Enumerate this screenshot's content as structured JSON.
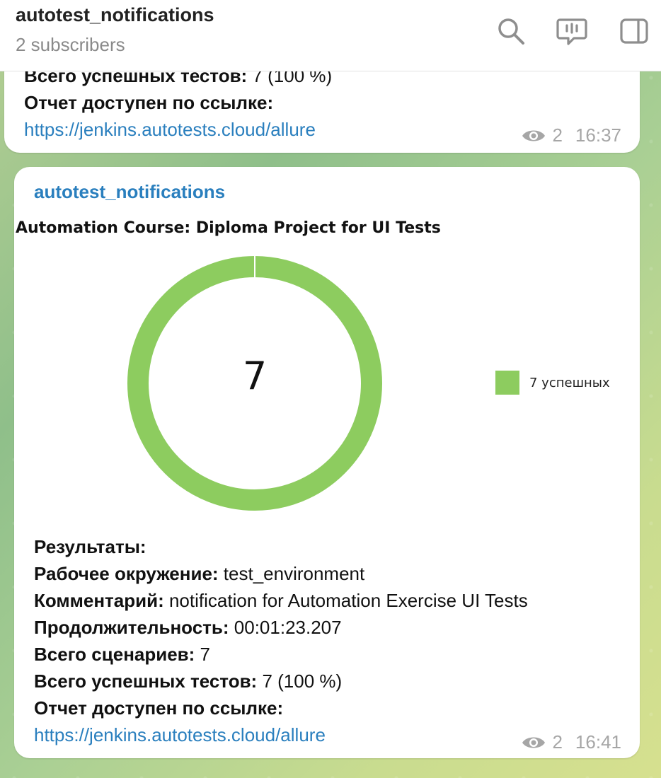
{
  "header": {
    "title": "autotest_notifications",
    "subtitle": "2 subscribers",
    "icons": [
      "search-icon",
      "live-chat-icon",
      "sidebar-toggle-icon"
    ]
  },
  "messages": [
    {
      "partial_top_line": {
        "label": "Всего успешных тестов:",
        "value": " 7 (100 %)"
      },
      "report_label": "Отчет доступен по ссылке:",
      "link": "https://jenkins.autotests.cloud/allure",
      "views": "2",
      "time": "16:37"
    },
    {
      "sender": "autotest_notifications",
      "results_heading": "Результаты:",
      "fields": [
        {
          "label": "Рабочее окружение:",
          "value": " test_environment"
        },
        {
          "label": "Комментарий:",
          "value": " notification for Automation Exercise UI Tests"
        },
        {
          "label": "Продолжительность:",
          "value": " 00:01:23.207"
        },
        {
          "label": "Всего сценариев:",
          "value": " 7"
        },
        {
          "label": "Всего успешных тестов:",
          "value": " 7 (100 %)"
        }
      ],
      "report_label": "Отчет доступен по ссылке:",
      "link": "https://jenkins.autotests.cloud/allure",
      "views": "2",
      "time": "16:41"
    }
  ],
  "chart_data": {
    "type": "pie",
    "title": "Automation Course: Diploma Project for UI Tests",
    "center_label": "7",
    "series": [
      {
        "name": "7 успешных",
        "values": [
          7
        ],
        "color": "#8dcc5f"
      }
    ],
    "legend_position": "right"
  }
}
